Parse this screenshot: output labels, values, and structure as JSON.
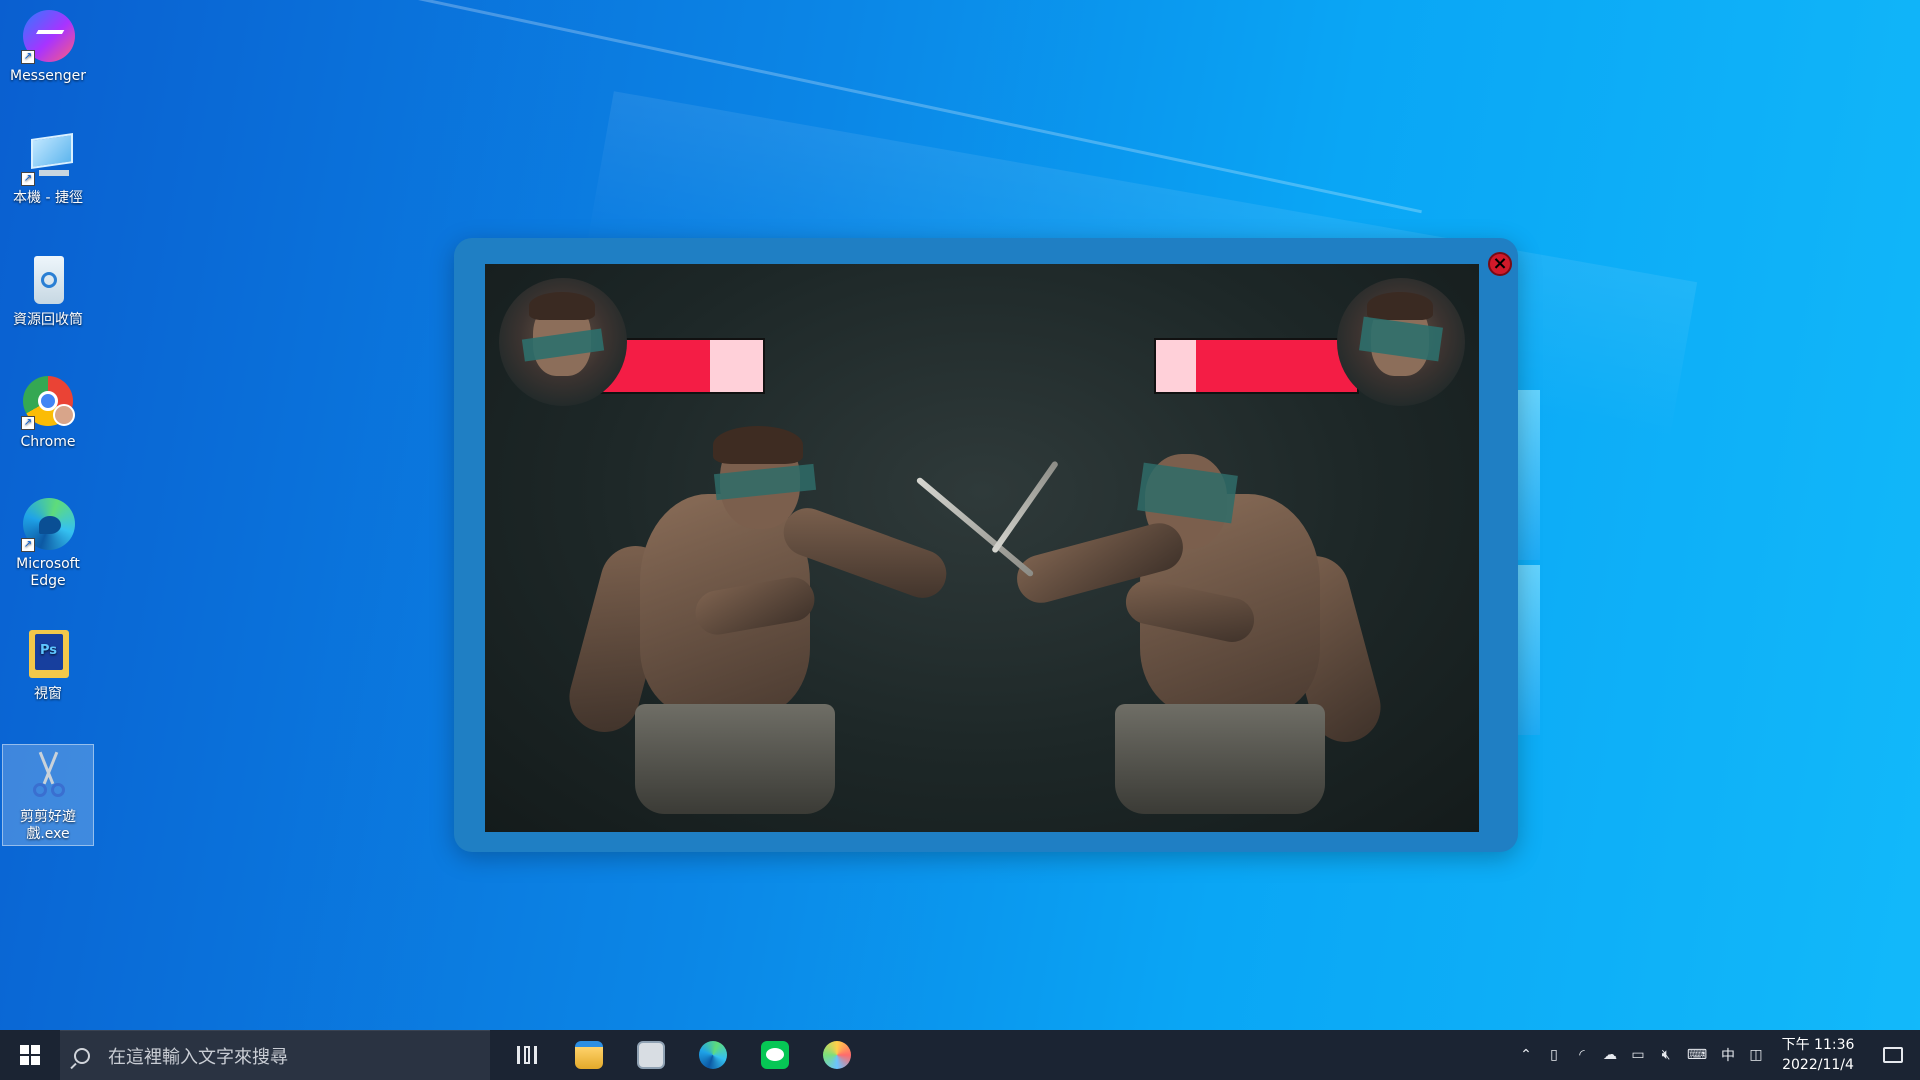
{
  "desktop": {
    "icons": [
      {
        "label": "Messenger",
        "icon": "messenger-icon"
      },
      {
        "label": "本機 - 捷徑",
        "icon": "computer-icon"
      },
      {
        "label": "資源回收筒",
        "icon": "recycle-bin-icon"
      },
      {
        "label": "Chrome",
        "icon": "chrome-icon"
      },
      {
        "label": "Microsoft Edge",
        "icon": "edge-icon"
      },
      {
        "label": "視窗",
        "icon": "folder-icon"
      },
      {
        "label": "剪剪好遊戲.exe",
        "icon": "scissors-icon"
      }
    ]
  },
  "game": {
    "close_icon": "close-icon",
    "player_left": {
      "health": 0.68
    },
    "player_right": {
      "health": 0.8
    },
    "colors": {
      "hp_fill": "#f41d45",
      "hp_empty": "#ffd0d9",
      "frame": "#1f7fc4"
    }
  },
  "taskbar": {
    "search_placeholder": "在這裡輸入文字來搜尋",
    "pinned": [
      "task-view-icon",
      "file-explorer-icon",
      "photos-icon",
      "edge-icon",
      "line-icon",
      "paint-icon"
    ],
    "tray": {
      "ime": "中",
      "time": "下午 11:36",
      "date": "2022/11/4"
    }
  }
}
